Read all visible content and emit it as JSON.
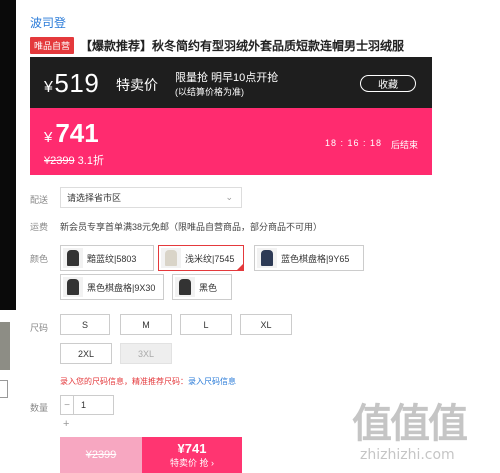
{
  "shop": {
    "brand": "波司登"
  },
  "product": {
    "badge": "唯品自营",
    "title": "【爆款推荐】秋冬简约有型羽绒外套品质短款连帽男士羽绒服"
  },
  "flash_sale": {
    "currency": "¥",
    "sale_price": "519",
    "sale_label": "特卖价",
    "limit_line1": "限量抢 明早10点开抢",
    "limit_line2": "(以结算价格为准)",
    "favorite_label": "收藏",
    "current_price": "741",
    "original_price": "¥2399",
    "discount": "3.1折",
    "countdown": "18 : 16 : 18",
    "countdown_suffix": "后结束"
  },
  "delivery": {
    "label": "配送",
    "value": "请选择省市区",
    "arrow": "⌄"
  },
  "freight": {
    "label": "运费",
    "text": "新会员专享首单满38元免邮（限唯品自营商品，部分商品不可用）"
  },
  "colors": {
    "label": "颜色",
    "options": [
      {
        "name": "黯蓝纹|5803",
        "selected": false
      },
      {
        "name": "浅米纹|7545",
        "selected": true
      },
      {
        "name": "蓝色棋盘格|9Y65",
        "selected": false
      },
      {
        "name": "黑色棋盘格|9X30",
        "selected": false
      },
      {
        "name": "黑色",
        "selected": false
      }
    ]
  },
  "sizes": {
    "label": "尺码",
    "options": [
      {
        "name": "S",
        "disabled": false
      },
      {
        "name": "M",
        "disabled": false
      },
      {
        "name": "L",
        "disabled": false
      },
      {
        "name": "XL",
        "disabled": false
      },
      {
        "name": "2XL",
        "disabled": false
      },
      {
        "name": "3XL",
        "disabled": true
      }
    ],
    "info_text": "录入您的尺码信息，精准推荐尺码：",
    "info_link": "录入尺码信息"
  },
  "quantity": {
    "label": "数量",
    "minus": "−",
    "value": "1",
    "plus": "+"
  },
  "actions": {
    "original_btn": "¥2399",
    "buy_price": "¥741",
    "buy_label": "特卖价 抢 ›"
  },
  "watermark": {
    "chars": "值值值",
    "url": "zhizhizhi.com"
  },
  "colors_theme": {
    "brand_pink": "#ff2b6f",
    "dark_bar": "#1e1e1e",
    "accent_red": "#e4393c",
    "link_blue": "#2a7bd8"
  }
}
